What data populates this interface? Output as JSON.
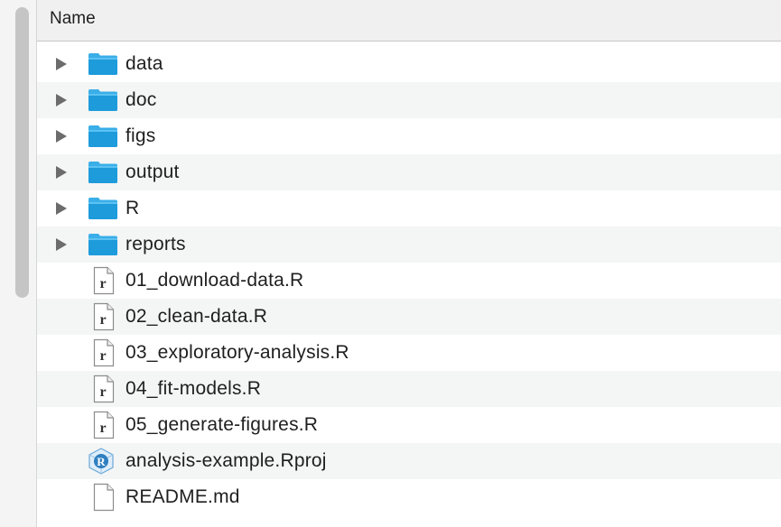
{
  "header": {
    "column_name": "Name"
  },
  "items": [
    {
      "label": "data",
      "kind": "folder",
      "icon": "folder-icon"
    },
    {
      "label": "doc",
      "kind": "folder",
      "icon": "folder-icon"
    },
    {
      "label": "figs",
      "kind": "folder",
      "icon": "folder-icon"
    },
    {
      "label": "output",
      "kind": "folder",
      "icon": "folder-icon"
    },
    {
      "label": "R",
      "kind": "folder",
      "icon": "folder-icon"
    },
    {
      "label": "reports",
      "kind": "folder",
      "icon": "folder-icon"
    },
    {
      "label": "01_download-data.R",
      "kind": "r-script",
      "icon": "r-script-icon",
      "badge": "r"
    },
    {
      "label": "02_clean-data.R",
      "kind": "r-script",
      "icon": "r-script-icon",
      "badge": "r"
    },
    {
      "label": "03_exploratory-analysis.R",
      "kind": "r-script",
      "icon": "r-script-icon",
      "badge": "r"
    },
    {
      "label": "04_fit-models.R",
      "kind": "r-script",
      "icon": "r-script-icon",
      "badge": "r"
    },
    {
      "label": "05_generate-figures.R",
      "kind": "r-script",
      "icon": "r-script-icon",
      "badge": "r"
    },
    {
      "label": "analysis-example.Rproj",
      "kind": "rproj",
      "icon": "rproj-icon",
      "badge": "R"
    },
    {
      "label": "README.md",
      "kind": "document",
      "icon": "document-icon"
    }
  ],
  "colors": {
    "folder": "#1d9bdb",
    "folder_light": "#5cc2f2",
    "disclosure": "#6c6c6c",
    "row_alt": "#f4f5f5"
  }
}
